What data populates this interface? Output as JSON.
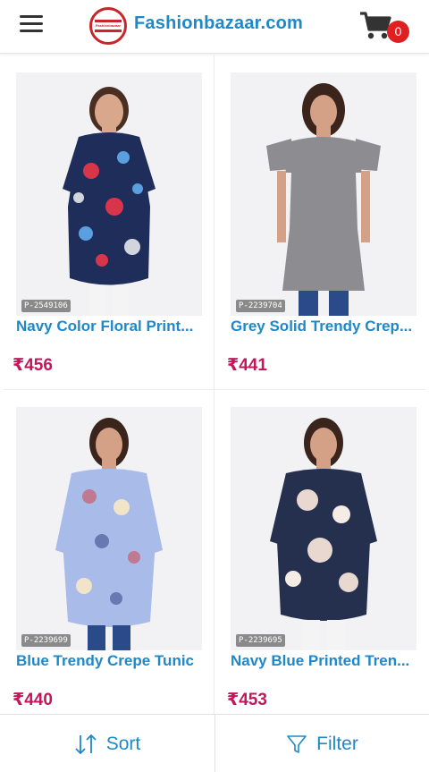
{
  "header": {
    "brand": "Fashionbazaar.com",
    "logo_text": "Fashionbazaar",
    "cart_count": "0"
  },
  "products": [
    {
      "sku": "P-2549106",
      "name": "Navy Color Floral Print...",
      "price": "₹456",
      "garment_color": "#1f2d5a",
      "accent_colors": [
        "#d9354a",
        "#5aa0e0",
        "#ffffff"
      ]
    },
    {
      "sku": "P-2239704",
      "name": "Grey Solid Trendy Crep...",
      "price": "₹441",
      "garment_color": "#8d8c91",
      "accent_colors": [
        "#8d8c91"
      ]
    },
    {
      "sku": "P-2239699",
      "name": "Blue Trendy Crepe Tunic",
      "price": "₹440",
      "garment_color": "#a9bbe9",
      "accent_colors": [
        "#c95c6b",
        "#3c4c8c",
        "#f1e4c8"
      ]
    },
    {
      "sku": "P-2239695",
      "name": "Navy Blue Printed Tren...",
      "price": "₹453",
      "garment_color": "#24304d",
      "accent_colors": [
        "#e9d8cf",
        "#f5ece6"
      ]
    }
  ],
  "bottom_bar": {
    "sort_label": "Sort",
    "filter_label": "Filter"
  },
  "colors": {
    "brand_blue": "#1e88c8",
    "price_red": "#c2185b",
    "badge_red": "#e02020"
  }
}
